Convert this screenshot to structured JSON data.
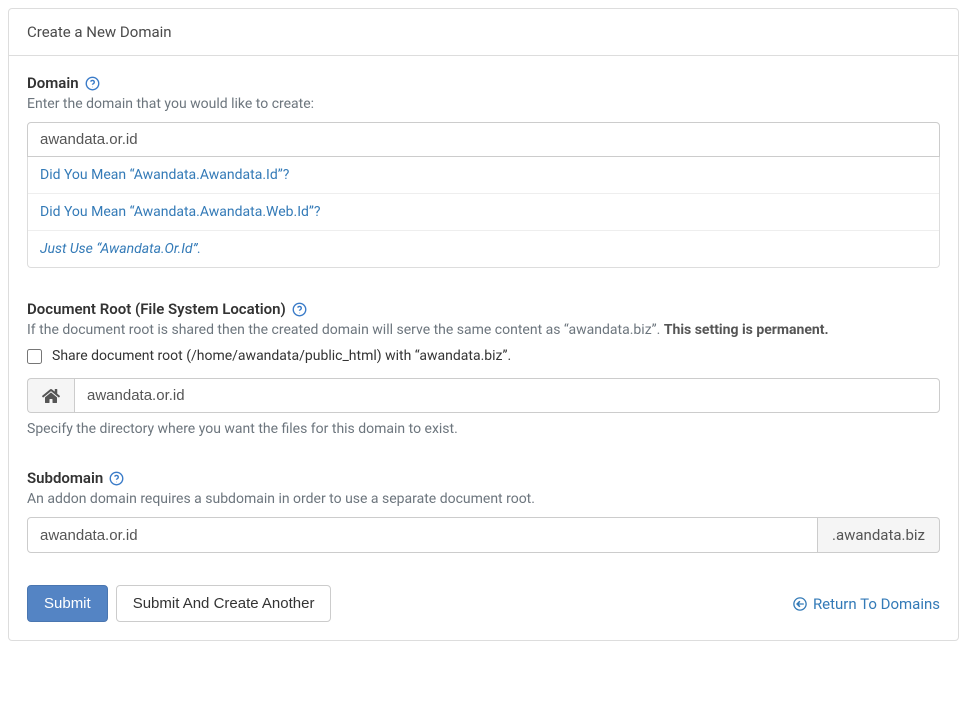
{
  "panel": {
    "title": "Create a New Domain"
  },
  "domain": {
    "label": "Domain",
    "hint": "Enter the domain that you would like to create:",
    "value": "awandata.or.id",
    "suggestions": [
      {
        "text": "Did You Mean “Awandata.Awandata.Id”?",
        "italic": false
      },
      {
        "text": "Did You Mean “Awandata.Awandata.Web.Id”?",
        "italic": false
      },
      {
        "text": "Just Use “Awandata.Or.Id”.",
        "italic": true
      }
    ]
  },
  "docroot": {
    "label": "Document Root (File System Location)",
    "hint_prefix": "If the document root is shared then the created domain will serve the same content as “awandata.biz”. ",
    "hint_bold": "This setting is permanent.",
    "checkbox_label": "Share document root (/home/awandata/public_html) with “awandata.biz”.",
    "value": "awandata.or.id",
    "after_hint": "Specify the directory where you want the files for this domain to exist."
  },
  "subdomain": {
    "label": "Subdomain",
    "hint": "An addon domain requires a subdomain in order to use a separate document root.",
    "value": "awandata.or.id",
    "suffix": ".awandata.biz"
  },
  "buttons": {
    "submit": "Submit",
    "submit_another": "Submit And Create Another",
    "return": "Return To Domains"
  }
}
